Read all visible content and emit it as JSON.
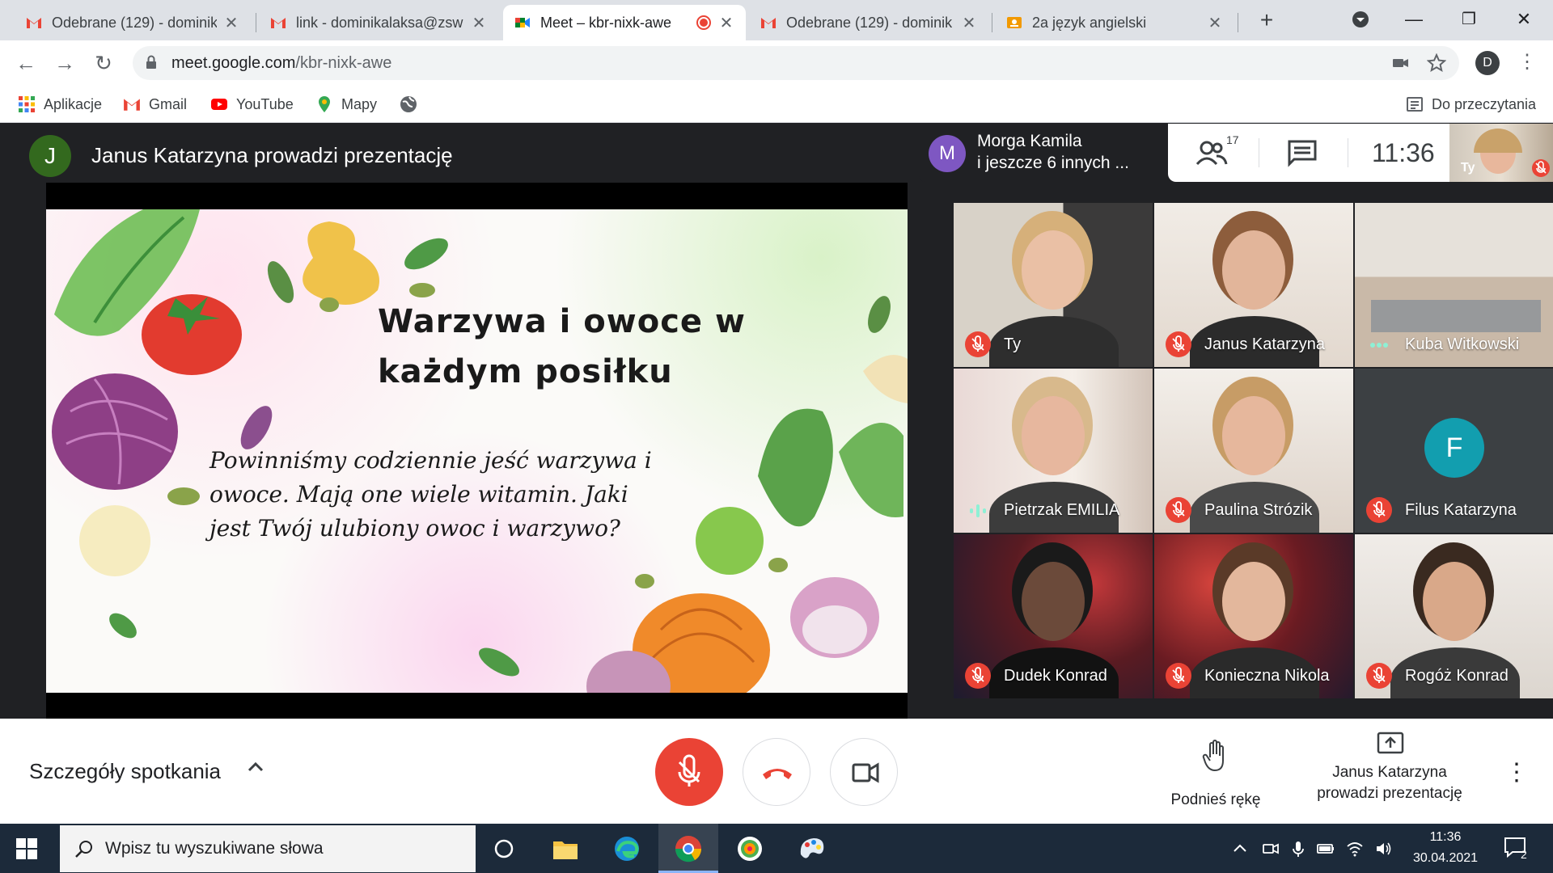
{
  "browser": {
    "tabs": [
      {
        "title": "Odebrane (129) - dominik",
        "icon": "gmail-icon",
        "active": false
      },
      {
        "title": "link - dominikalaksa@zsw",
        "icon": "gmail-icon",
        "active": false
      },
      {
        "title": "Meet – kbr-nixk-awe",
        "icon": "meet-icon",
        "active": true
      },
      {
        "title": "Odebrane (129) - dominik",
        "icon": "gmail-icon",
        "active": false
      },
      {
        "title": "2a język angielski",
        "icon": "classroom-icon",
        "active": false
      }
    ],
    "url_host": "meet.google.com",
    "url_path": "/kbr-nixk-awe",
    "profile_initial": "D",
    "bookmarks": [
      {
        "label": "Aplikacje",
        "icon": "apps-grid-icon"
      },
      {
        "label": "Gmail",
        "icon": "gmail-icon"
      },
      {
        "label": "YouTube",
        "icon": "youtube-icon"
      },
      {
        "label": "Mapy",
        "icon": "maps-pin-icon"
      },
      {
        "label": "",
        "icon": "globe-icon"
      }
    ],
    "reading_list": "Do przeczytania"
  },
  "meet": {
    "presenter": {
      "initial": "J",
      "text": "Janus Katarzyna prowadzi prezentację"
    },
    "slide": {
      "title": "Warzywa i owoce w każdym posiłku",
      "body": "Powinniśmy codziennie jeść warzywa i owoce. Mają one wiele witamin. Jaki jest Twój ulubiony owoc i warzywo?"
    },
    "others": {
      "initial": "M",
      "name": "Morga Kamila",
      "more": "i jeszcze 6 innych ..."
    },
    "people_count": "17",
    "time": "11:36",
    "self_label": "Ty",
    "participants": [
      {
        "name": "Ty",
        "status": "muted"
      },
      {
        "name": "Janus Katarzyna",
        "status": "muted"
      },
      {
        "name": "Kuba Witkowski",
        "status": "dots"
      },
      {
        "name": "Pietrzak EMILIA",
        "status": "talking"
      },
      {
        "name": "Paulina Strózik",
        "status": "muted"
      },
      {
        "name": "Filus Katarzyna",
        "status": "muted",
        "initial": "F"
      },
      {
        "name": "Dudek Konrad",
        "status": "muted"
      },
      {
        "name": "Konieczna Nikola",
        "status": "muted"
      },
      {
        "name": "Rogóż Konrad",
        "status": "muted"
      }
    ],
    "details_label": "Szczegóły spotkania",
    "raise_hand_label": "Podnieś rękę",
    "present_line1": "Janus Katarzyna",
    "present_line2": "prowadzi prezentację"
  },
  "taskbar": {
    "search_placeholder": "Wpisz tu wyszukiwane słowa",
    "time": "11:36",
    "date": "30.04.2021",
    "notifications": "2"
  },
  "colors": {
    "meet_bg": "#202124",
    "red": "#ea4335",
    "taskbar": "#1c2a3a"
  }
}
